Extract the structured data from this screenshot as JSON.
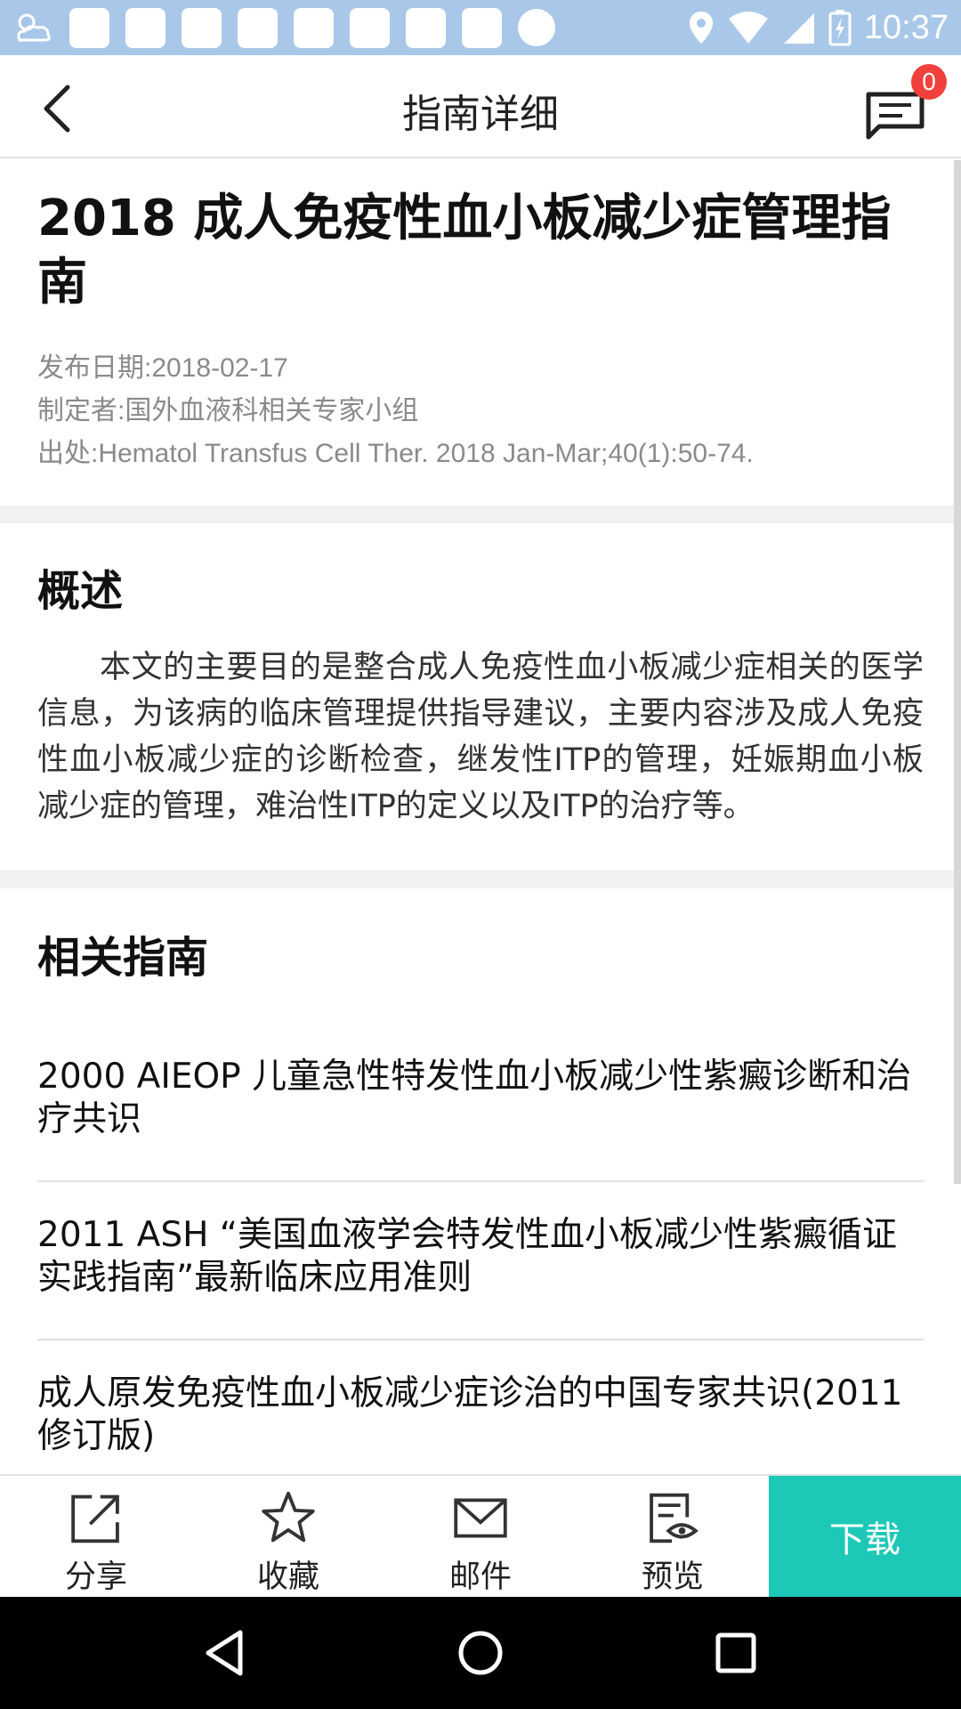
{
  "status_bar": {
    "time": "10:37",
    "icons": [
      "weather-icon",
      "app-icon",
      "notification-icon",
      "location-icon",
      "wifi-icon",
      "signal-icon",
      "battery-icon"
    ]
  },
  "header": {
    "title": "指南详细",
    "badge_count": "0"
  },
  "doc": {
    "title": "2018 成人免疫性血小板减少症管理指南",
    "publish_date": "发布日期:2018-02-17",
    "author": "制定者:国外血液科相关专家小组",
    "source": "出处:Hematol Transfus Cell Ther. 2018 Jan-Mar;40(1):50-74."
  },
  "summary": {
    "title": "概述",
    "text": "本文的主要目的是整合成人免疫性血小板减少症相关的医学信息，为该病的临床管理提供指导建议，主要内容涉及成人免疫性血小板减少症的诊断检查，继发性ITP的管理，妊娠期血小板减少症的管理，难治性ITP的定义以及ITP的治疗等。"
  },
  "related": {
    "title": "相关指南",
    "items": [
      {
        "label": "2000 AIEOP 儿童急性特发性血小板减少性紫癜诊断和治疗共识"
      },
      {
        "label": "2011 ASH “美国血液学会特发性血小板减少性紫癜循证实践指南”最新临床应用准则"
      },
      {
        "label": "成人原发免疫性血小板减少症诊治的中国专家共识(2011修订版)"
      }
    ]
  },
  "toolbar": {
    "share": "分享",
    "favorite": "收藏",
    "email": "邮件",
    "preview": "预览",
    "download": "下载"
  },
  "colors": {
    "status_bar": "#a9c8e9",
    "accent": "#1ec8b7",
    "badge": "#f0413c"
  }
}
